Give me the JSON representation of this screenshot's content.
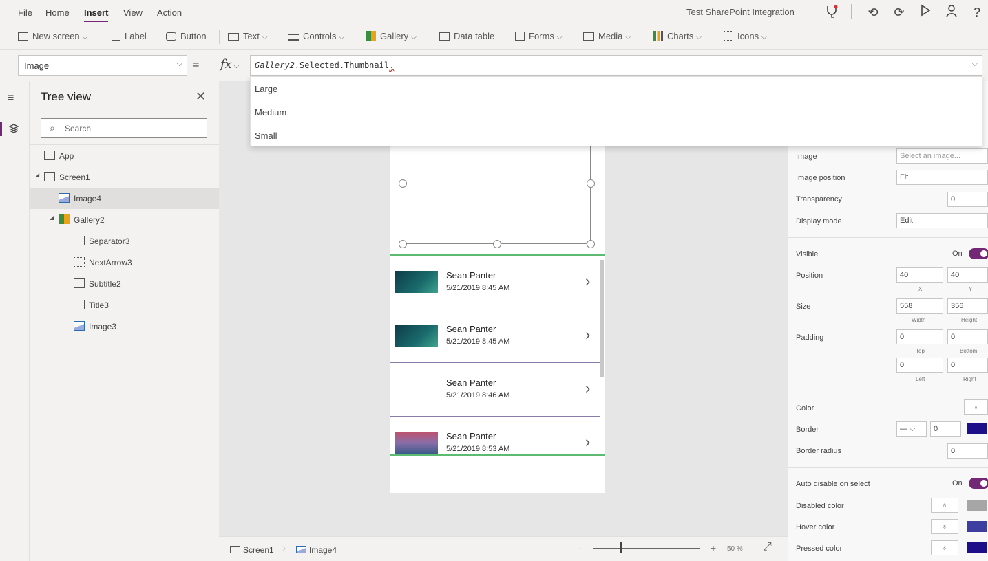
{
  "menu": {
    "items": [
      "File",
      "Home",
      "Insert",
      "View",
      "Action"
    ],
    "active": "Insert"
  },
  "app_name": "Test SharePoint Integration",
  "toolbar": {
    "new_screen": "New screen",
    "label": "Label",
    "button": "Button",
    "text": "Text",
    "controls": "Controls",
    "gallery": "Gallery",
    "data_table": "Data table",
    "forms": "Forms",
    "media": "Media",
    "charts": "Charts",
    "icons": "Icons"
  },
  "formula": {
    "property": "Image",
    "equals": "=",
    "fx": "fx",
    "ident": "Gallery2",
    "rest": ".Selected.Thumbnail",
    "trailing": "."
  },
  "autocomplete": [
    "Large",
    "Medium",
    "Small"
  ],
  "tree": {
    "title": "Tree view",
    "search_placeholder": "Search",
    "items": [
      {
        "label": "App"
      },
      {
        "label": "Screen1"
      },
      {
        "label": "Image4"
      },
      {
        "label": "Gallery2"
      },
      {
        "label": "Separator3"
      },
      {
        "label": "NextArrow3"
      },
      {
        "label": "Subtitle2"
      },
      {
        "label": "Title3"
      },
      {
        "label": "Image3"
      }
    ],
    "selected": "Image4"
  },
  "gallery": {
    "rows": [
      {
        "title": "Sean Panter",
        "date": "5/21/2019 8:45 AM"
      },
      {
        "title": "Sean Panter",
        "date": "5/21/2019 8:45 AM"
      },
      {
        "title": "Sean Panter",
        "date": "5/21/2019 8:46 AM"
      },
      {
        "title": "Sean Panter",
        "date": "5/21/2019 8:53 AM"
      }
    ]
  },
  "statusbar": {
    "screen": "Screen1",
    "control": "Image4",
    "zoom": "50 %"
  },
  "properties": {
    "image_label": "Image",
    "image_value": "Select an image...",
    "image_position_label": "Image position",
    "image_position_value": "Fit",
    "transparency_label": "Transparency",
    "transparency_value": "0",
    "display_mode_label": "Display mode",
    "display_mode_value": "Edit",
    "visible_label": "Visible",
    "visible_state": "On",
    "position_label": "Position",
    "position_x": "40",
    "position_y": "40",
    "x_label": "X",
    "y_label": "Y",
    "size_label": "Size",
    "width_value": "558",
    "height_value": "356",
    "width_label": "Width",
    "height_label": "Height",
    "padding_label": "Padding",
    "pad_top": "0",
    "pad_bottom": "0",
    "pad_left": "0",
    "pad_right": "0",
    "top_label": "Top",
    "bottom_label": "Bottom",
    "left_label": "Left",
    "right_label": "Right",
    "color_label": "Color",
    "border_label": "Border",
    "border_value": "0",
    "border_radius_label": "Border radius",
    "border_radius_value": "0",
    "auto_disable_label": "Auto disable on select",
    "auto_disable_state": "On",
    "disabled_color_label": "Disabled color",
    "hover_color_label": "Hover color",
    "pressed_color_label": "Pressed color"
  },
  "colors": {
    "accent": "#742774",
    "gallery_line": "#5dba73",
    "border_swatch": "#1d0f8a",
    "disabled_swatch": "#a6a6a6",
    "hover_swatch": "#3e3ea1",
    "pressed_swatch": "#1d0f8a"
  }
}
